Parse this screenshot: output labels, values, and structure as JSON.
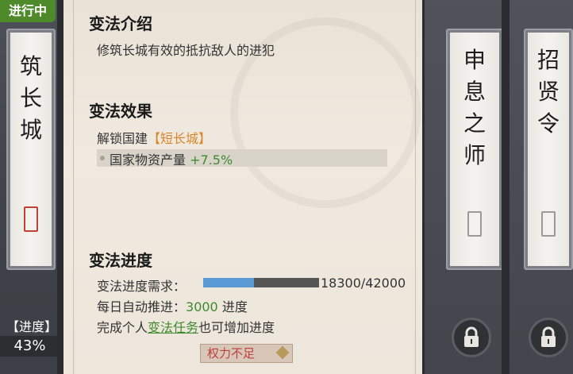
{
  "left_card": {
    "status_badge": "进行中",
    "title_chars": [
      "筑",
      "长",
      "城"
    ],
    "progress_label": "【进度】",
    "progress_value": "43%"
  },
  "right_cards": [
    {
      "title_chars": [
        "申",
        "息",
        "之",
        "师"
      ],
      "locked": true
    },
    {
      "title_chars": [
        "招",
        "贤",
        "令"
      ],
      "locked": true
    }
  ],
  "main": {
    "intro_heading": "变法介绍",
    "intro_text": "修筑长城有效的抵抗敌人的进犯",
    "effect_heading": "变法效果",
    "unlock_prefix": "解锁国建",
    "unlock_item": "【短长城】",
    "effect_label": "国家物资产量",
    "effect_value": "+7.5%",
    "progress_heading": "变法进度",
    "progress_req_label": "变法进度需求：",
    "progress_current": 18300,
    "progress_total": 42000,
    "progress_text": "18300/42000",
    "daily_prefix": "每日自动推进：",
    "daily_value": "3000",
    "daily_suffix": " 进度",
    "task_prefix": "完成个人",
    "task_link": "变法任务",
    "task_suffix": "也可增加进度",
    "button_label": "权力不足"
  },
  "colors": {
    "accent_green": "#3f8a2e",
    "accent_orange": "#d9862a",
    "bar_fill": "#5a9bd6",
    "button_text": "#c0413a"
  }
}
